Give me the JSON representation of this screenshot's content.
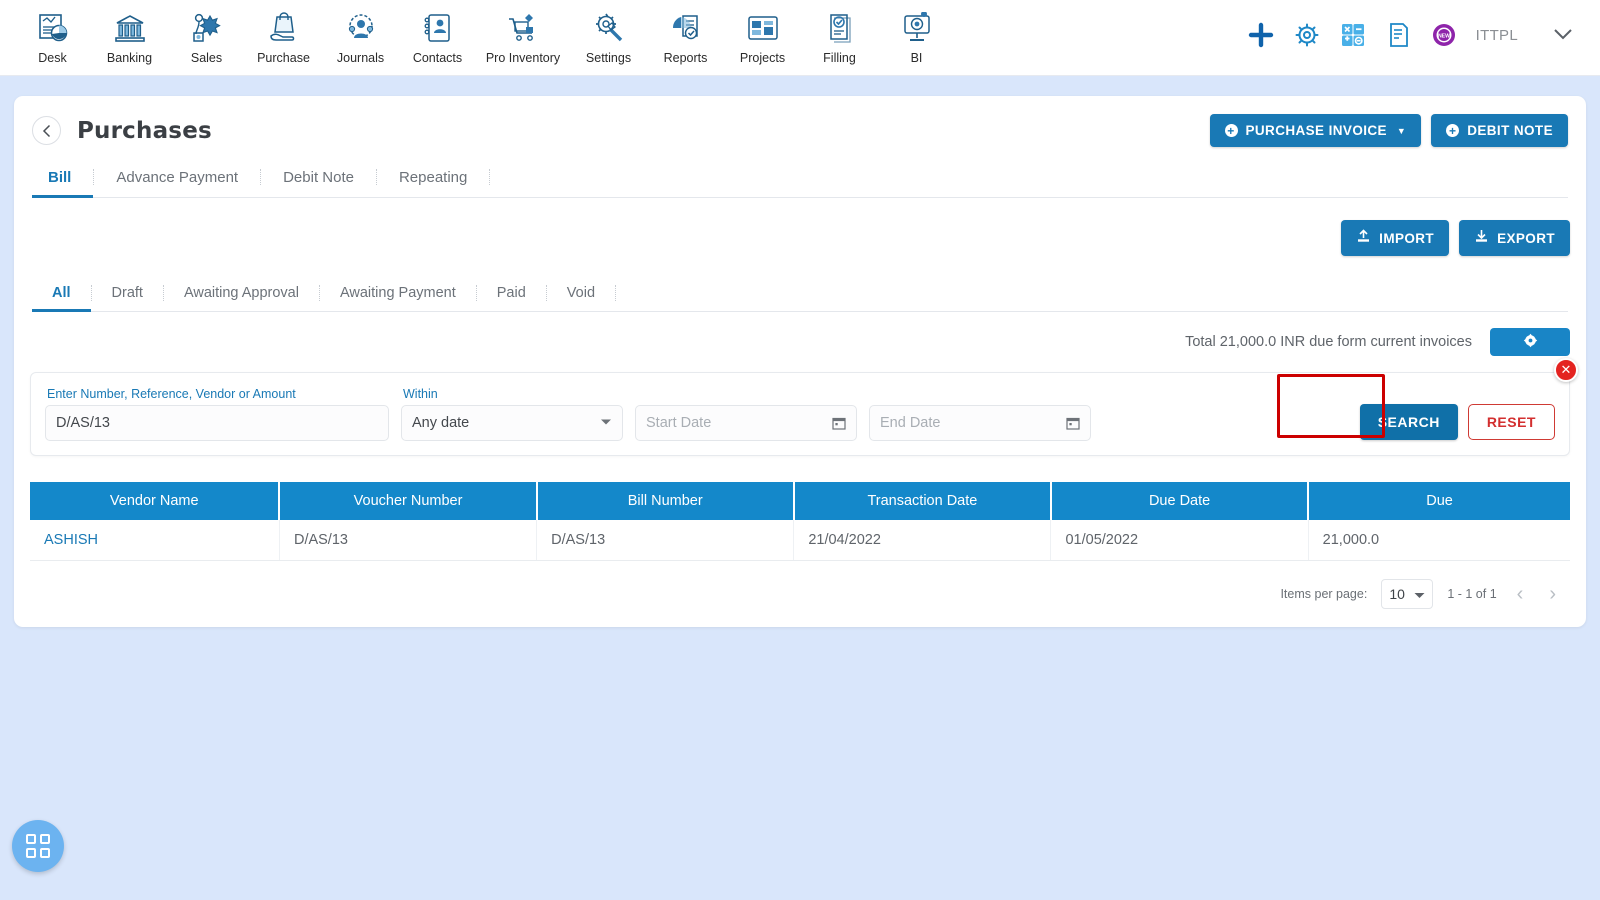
{
  "topnav": {
    "modules": [
      {
        "label": "Desk",
        "icon": "dashboard-icon"
      },
      {
        "label": "Banking",
        "icon": "bank-icon"
      },
      {
        "label": "Sales",
        "icon": "sales-icon"
      },
      {
        "label": "Purchase",
        "icon": "purchase-icon"
      },
      {
        "label": "Journals",
        "icon": "journals-icon"
      },
      {
        "label": "Contacts",
        "icon": "contacts-icon"
      },
      {
        "label": "Pro Inventory",
        "icon": "inventory-icon"
      },
      {
        "label": "Settings",
        "icon": "settings-icon"
      },
      {
        "label": "Reports",
        "icon": "reports-icon"
      },
      {
        "label": "Projects",
        "icon": "projects-icon"
      },
      {
        "label": "Filling",
        "icon": "filling-icon"
      },
      {
        "label": "BI",
        "icon": "bi-icon"
      }
    ],
    "actions": [
      {
        "name": "add-icon"
      },
      {
        "name": "gear-icon"
      },
      {
        "name": "calculator-icon"
      },
      {
        "name": "notes-icon"
      },
      {
        "name": "new-badge-icon"
      }
    ],
    "org_name": "ITTPL",
    "org_chevron": "⌄"
  },
  "header": {
    "back_icon": "‹",
    "title": "Purchases",
    "purchase_invoice_label": "PURCHASE INVOICE",
    "debit_note_label": "DEBIT NOTE",
    "plus_glyph": "+",
    "caret_glyph": "▼"
  },
  "doc_tabs": [
    {
      "label": "Bill",
      "active": true
    },
    {
      "label": "Advance Payment",
      "active": false
    },
    {
      "label": "Debit Note",
      "active": false
    },
    {
      "label": "Repeating",
      "active": false
    }
  ],
  "io": {
    "import_label": "IMPORT",
    "export_label": "EXPORT",
    "upload_icon": "upload-icon",
    "download_icon": "download-icon"
  },
  "status_tabs": [
    {
      "label": "All",
      "active": true
    },
    {
      "label": "Draft",
      "active": false
    },
    {
      "label": "Awaiting Approval",
      "active": false
    },
    {
      "label": "Awaiting Payment",
      "active": false
    },
    {
      "label": "Paid",
      "active": false
    },
    {
      "label": "Void",
      "active": false
    }
  ],
  "summary": {
    "total_text": "Total 21,000.0 INR due form current invoices",
    "gear_icon": "gear-icon"
  },
  "filter": {
    "close_glyph": "✕",
    "search_label": "Enter Number, Reference, Vendor or Amount",
    "search_value": "D/AS/13",
    "within_label": "Within",
    "within_value": "Any date",
    "start_date_placeholder": "Start Date",
    "end_date_placeholder": "End Date",
    "search_button": "SEARCH",
    "reset_button": "RESET",
    "highlight_color": "#cc0000"
  },
  "table": {
    "columns": [
      "Vendor Name",
      "Voucher Number",
      "Bill Number",
      "Transaction Date",
      "Due Date",
      "Due"
    ],
    "rows": [
      {
        "vendor_name": "ASHISH",
        "voucher_number": "D/AS/13",
        "bill_number": "D/AS/13",
        "transaction_date": "21/04/2022",
        "due_date": "01/05/2022",
        "due": "21,000.0"
      }
    ]
  },
  "pagination": {
    "items_per_page_label": "Items per page:",
    "items_per_page_value": "10",
    "range_text": "1 - 1 of 1",
    "prev_glyph": "‹",
    "next_glyph": "›"
  },
  "fab": {
    "icon": "apps-grid-icon"
  },
  "colors": {
    "page_bg": "#d9e6fb",
    "accent": "#1979b5",
    "table_header": "#1488ca",
    "danger": "#e42320"
  }
}
